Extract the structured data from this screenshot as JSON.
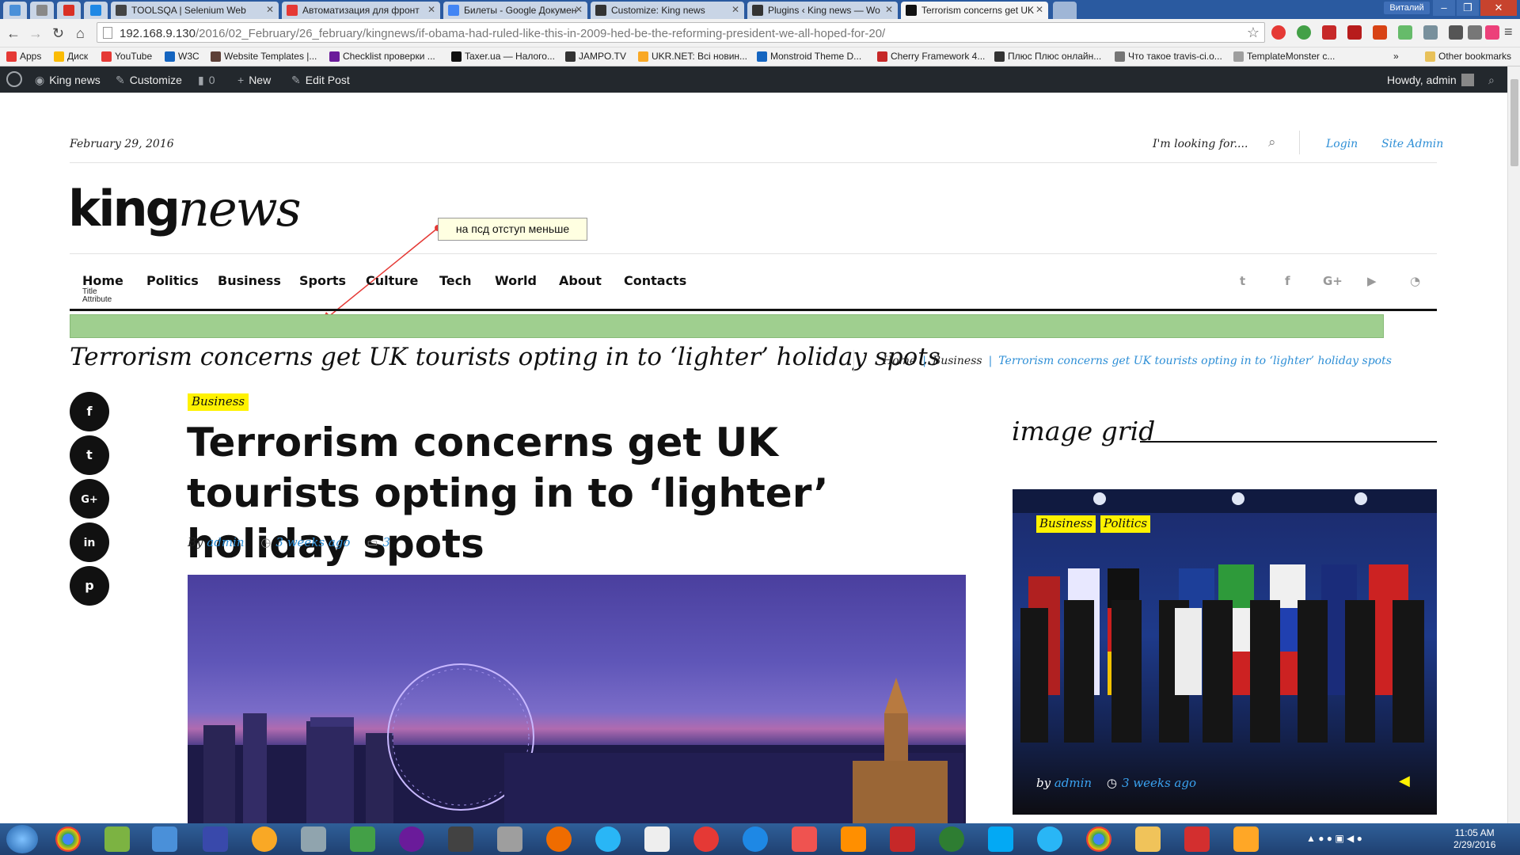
{
  "browser": {
    "tabs": [
      {
        "label": "",
        "color": "#4a90d9"
      },
      {
        "label": "",
        "color": "#888888"
      },
      {
        "label": "M",
        "color": "#d93025"
      },
      {
        "label": "",
        "color": "#1e88e5"
      },
      {
        "label": "TOOLSQA | Selenium Web",
        "color": "#444444"
      },
      {
        "label": "Автоматизация для фронт",
        "color": "#e53935"
      },
      {
        "label": "Билеты - Google Докумен",
        "color": "#4285f4"
      },
      {
        "label": "Customize: King news",
        "color": "#333333"
      },
      {
        "label": "Plugins ‹ King news — Wo",
        "color": "#333333"
      },
      {
        "label": "Terrorism concerns get UK",
        "color": "#111111"
      }
    ],
    "user_name": "Виталий",
    "url_prefix": "192.168.9.130",
    "url_path": "/2016/02_February/26_february/kingnews/if-obama-had-ruled-like-this-in-2009-hed-be-the-reforming-president-we-all-hoped-for-20/",
    "bookmarks": [
      {
        "label": "Apps",
        "color": "#e53935"
      },
      {
        "label": "Диск",
        "color": "#fbbc05"
      },
      {
        "label": "YouTube",
        "color": "#e53935"
      },
      {
        "label": "W3C",
        "color": "#1565c0"
      },
      {
        "label": "Website Templates |...",
        "color": "#5d4037"
      },
      {
        "label": "Checklist проверки ...",
        "color": "#6a1b9a"
      },
      {
        "label": "Taxer.ua — Налого...",
        "color": "#111111"
      },
      {
        "label": "JAMPO.TV",
        "color": "#333333"
      },
      {
        "label": "UKR.NET: Всі новин...",
        "color": "#f9a825"
      },
      {
        "label": "Monstroid Theme D...",
        "color": "#1565c0"
      },
      {
        "label": "Cherry Framework 4...",
        "color": "#c62828"
      },
      {
        "label": "Плюс Плюс онлайн...",
        "color": "#333333"
      },
      {
        "label": "Что такое travis-ci.o...",
        "color": "#757575"
      },
      {
        "label": "TemplateMonster c...",
        "color": "#9e9e9e"
      }
    ],
    "more_bookmarks": "»",
    "other_bookmarks": "Other bookmarks"
  },
  "adminbar": {
    "site_name": "King news",
    "customize": "Customize",
    "comments_count": "0",
    "new_label": "New",
    "edit_post": "Edit Post",
    "howdy": "Howdy, admin"
  },
  "header": {
    "date": "February 29, 2016",
    "search_placeholder": "I'm looking for....",
    "login": "Login",
    "site_admin": "Site Admin",
    "logo_a": "king",
    "logo_b": "news"
  },
  "annotation": {
    "note": "на псд отступ меньше",
    "color": "#e53935"
  },
  "nav": {
    "items": [
      "Home",
      "Politics",
      "Business",
      "Sports",
      "Culture",
      "Tech",
      "World",
      "About",
      "Contacts"
    ],
    "attr_line1": "Title",
    "attr_line2": "Attribute",
    "social": [
      "twitter-icon",
      "facebook-icon",
      "google-plus-icon",
      "youtube-icon",
      "rss-icon"
    ],
    "highlight_color": "#9fcf8f"
  },
  "page_title": "Terrorism concerns get UK tourists opting in to ‘lighter’ holiday spots",
  "breadcrumb": {
    "home": "Home",
    "sep": "|",
    "category": "Business",
    "current": "Terrorism concerns get UK tourists opting in to ‘lighter’ holiday spots"
  },
  "share_icons": [
    "facebook-icon",
    "twitter-icon",
    "google-plus-icon",
    "linkedin-icon",
    "pinterest-icon"
  ],
  "article": {
    "category": "Business",
    "headline": "Terrorism concerns get UK tourists opting in to ‘lighter’ holiday spots",
    "by": "By",
    "author": "admin",
    "time": "3 weeks ago",
    "comments": "3"
  },
  "sidebar": {
    "title": "image grid",
    "badges": [
      "Business",
      "Politics"
    ],
    "by": "by",
    "author": "admin",
    "time": "3 weeks ago"
  },
  "taskbar": {
    "time": "11:05 AM",
    "date": "2/29/2016"
  },
  "colors": {
    "accent": "#2e8fd6",
    "badge": "#fff200",
    "adminbar": "#23282d"
  }
}
